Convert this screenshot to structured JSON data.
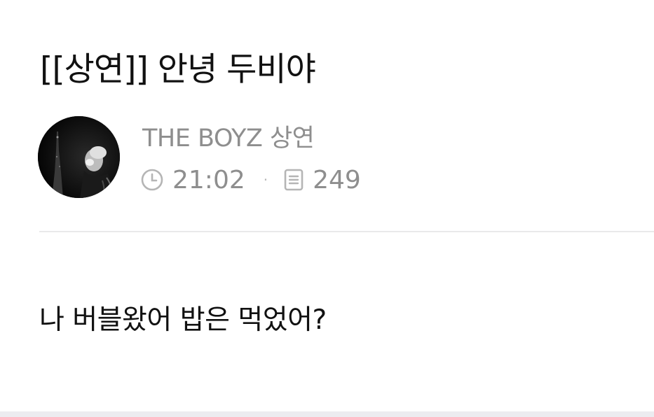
{
  "post": {
    "title": "[[상연]] 안녕 두비야",
    "author": "THE BOYZ 상연",
    "time": "21:02",
    "views": "249",
    "separator": "·",
    "body": "나 버블왔어 밥은 먹었어?"
  },
  "icons": {
    "time": "clock-icon",
    "views": "document-icon"
  },
  "colors": {
    "title": "#111111",
    "meta": "#8e8e8e",
    "divider": "#e9e9ea",
    "background": "#ffffff"
  }
}
